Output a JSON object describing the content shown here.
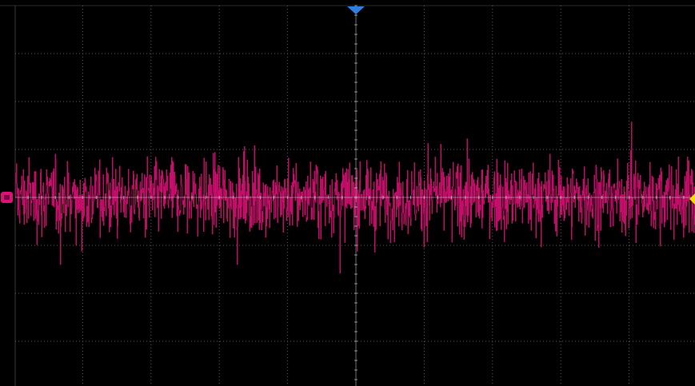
{
  "display": {
    "background": "#000000",
    "grid_color": "#5a5a5a",
    "divisions": {
      "horizontal": 10,
      "vertical": 8
    },
    "subdivisions_per_division": 5
  },
  "channel": {
    "label": "",
    "color": "#e0107a",
    "signal": "random-noise",
    "offset_divisions": 0,
    "mean_amplitude_divisions": 1.0,
    "peak_amplitude_divisions": 3.0
  },
  "markers": {
    "channel_ground_icon": "channel-offset-marker",
    "channel_ground_color": "#e0107a",
    "trigger_position_icon": "trigger-position-triangle",
    "trigger_position_color": "#2f7fe0",
    "trigger_level_icon": "trigger-level-arrow",
    "trigger_level_color": "#f0e000"
  }
}
